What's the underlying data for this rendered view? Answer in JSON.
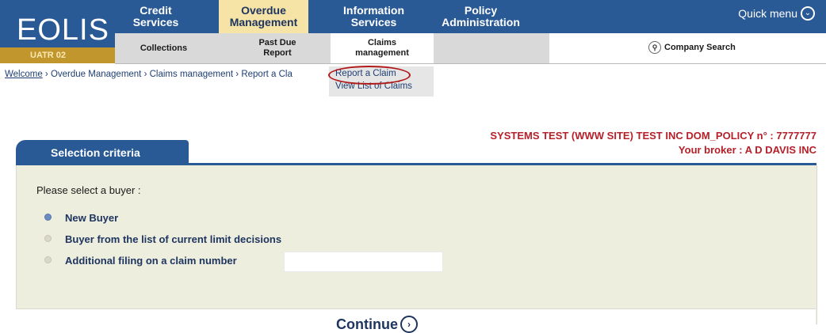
{
  "logo": {
    "text": "EOLIS",
    "sub": "UATR 02"
  },
  "top_nav": [
    {
      "line1": "Credit",
      "line2": "Services"
    },
    {
      "line1": "Overdue",
      "line2": "Management"
    },
    {
      "line1": "Information",
      "line2": "Services"
    },
    {
      "line1": "Policy",
      "line2": "Administration"
    }
  ],
  "quick_menu": {
    "label": "Quick menu",
    "icon": "chevron-down-circle-icon"
  },
  "sub_nav": [
    {
      "line1": "Collections",
      "line2": ""
    },
    {
      "line1": "Past Due",
      "line2": "Report"
    },
    {
      "line1": "Claims",
      "line2": "management"
    }
  ],
  "company_search": {
    "label": "Company Search",
    "icon": "magnifier-icon"
  },
  "breadcrumb": {
    "home": "Welcome",
    "sep": " › ",
    "c1": "Overdue Management",
    "c2": "Claims management",
    "c3": "Report a Cla"
  },
  "dropdown": {
    "item1": "Report a Claim",
    "item2": "View List of Claims"
  },
  "policy": {
    "line1": "SYSTEMS TEST (WWW SITE) TEST INC DOM_POLICY n° : 7777777",
    "line2": "Your broker : A D DAVIS INC"
  },
  "section_title": "Selection criteria",
  "prompt": "Please select a buyer :",
  "options": {
    "new_buyer": "New Buyer",
    "from_list": "Buyer from the list of current limit decisions",
    "additional": "Additional filing on a claim number"
  },
  "claim_number_value": "",
  "continue_label": "Continue",
  "colors": {
    "brand_blue": "#2a5a95",
    "accent_gold": "#c1962c",
    "active_tab": "#f6e3a6",
    "policy_red": "#b5202a",
    "panel_bg": "#eeeede"
  }
}
